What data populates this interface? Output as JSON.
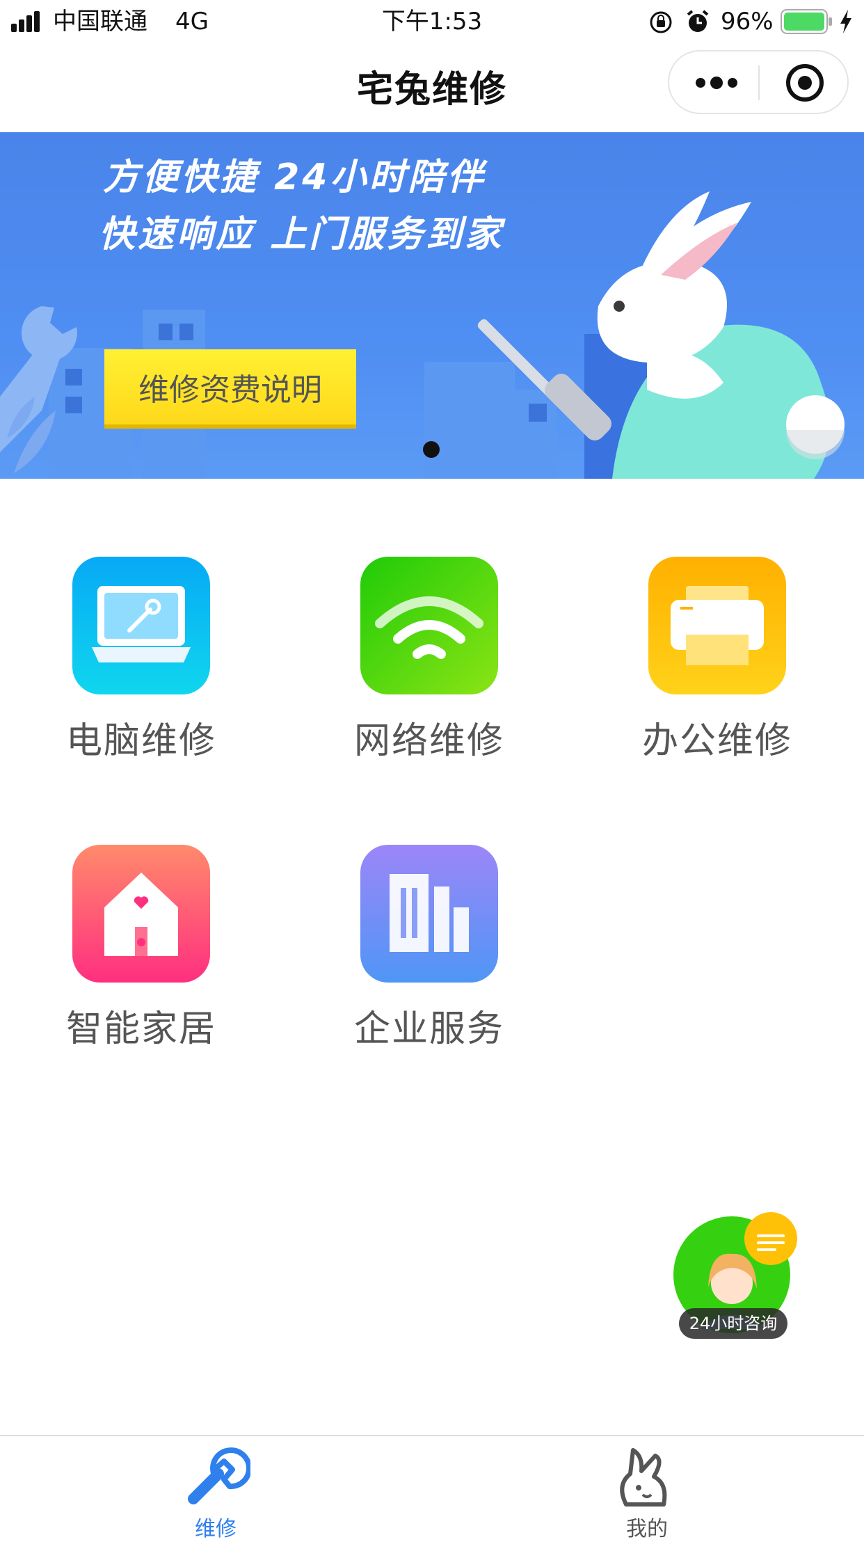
{
  "status_bar": {
    "carrier": "中国联通",
    "network": "4G",
    "time": "下午1:53",
    "battery_percent": "96%"
  },
  "nav": {
    "title": "宅兔维修"
  },
  "banner": {
    "line1": "方便快捷 24小时陪伴",
    "line2": "快速响应 上门服务到家",
    "button_label": "维修资费说明"
  },
  "services": [
    {
      "label": "电脑维修",
      "icon": "laptop-repair-icon",
      "color": "#10b6f5"
    },
    {
      "label": "网络维修",
      "icon": "wifi-icon",
      "color": "#3fd40f"
    },
    {
      "label": "办公维修",
      "icon": "printer-icon",
      "color": "#ffb400"
    },
    {
      "label": "智能家居",
      "icon": "smart-home-icon",
      "color": "#ff4f7e"
    },
    {
      "label": "企业服务",
      "icon": "enterprise-building-icon",
      "color": "#7d8cf7"
    }
  ],
  "consult": {
    "label": "24小时咨询"
  },
  "tabbar": {
    "tabs": [
      {
        "label": "维修",
        "icon": "wrench-icon",
        "active": true
      },
      {
        "label": "我的",
        "icon": "rabbit-icon",
        "active": false
      }
    ],
    "active_color": "#2f80ed",
    "inactive_color": "#555555"
  }
}
